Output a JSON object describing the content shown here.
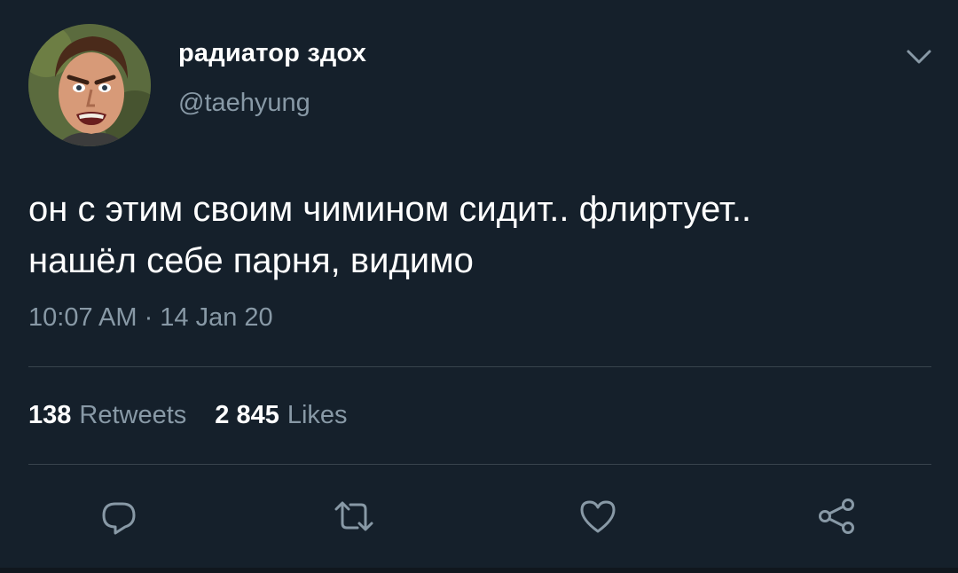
{
  "user": {
    "display_name": "радиатор здох",
    "handle": "@taehyung",
    "avatar_icon": "cartoon-face-avatar"
  },
  "tweet": {
    "text_line1": "он с этим своим чимином сидит.. флиртует..",
    "text_line2": "нашёл себе парня, видимо",
    "timestamp": "10:07 AM · 14 Jan 20"
  },
  "stats": {
    "retweets_count": "138",
    "retweets_label": "Retweets",
    "likes_count": "2 845",
    "likes_label": "Likes"
  },
  "actions": {
    "reply_icon": "reply-icon",
    "retweet_icon": "retweet-icon",
    "like_icon": "heart-icon",
    "share_icon": "share-icon"
  },
  "colors": {
    "background": "#15202b",
    "secondary_text": "#8899a6",
    "divider": "#38444d"
  }
}
